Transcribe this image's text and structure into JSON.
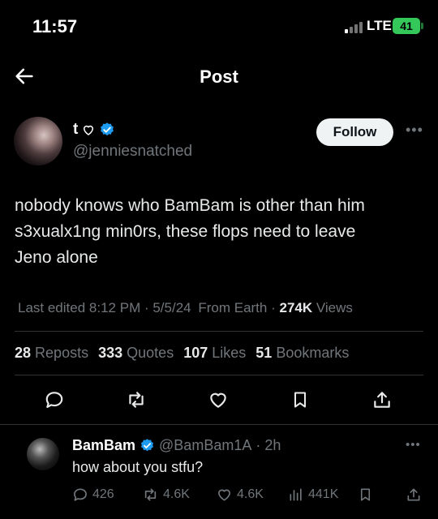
{
  "status_bar": {
    "time": "11:57",
    "network": "LTE",
    "battery": "41"
  },
  "header": {
    "title": "Post"
  },
  "post": {
    "author": {
      "display_name": "t",
      "handle": "@jenniesnatched"
    },
    "follow_label": "Follow",
    "text": "nobody knows who BamBam is other than him\ns3xualx1ng min0rs, these flops need to leave\nJeno alone",
    "meta": {
      "edited_label": "Last edited",
      "time": "8:12 PM",
      "date": "5/5/24",
      "location": "From Earth",
      "views_count": "274K",
      "views_label": "Views"
    },
    "stats": {
      "reposts": {
        "count": "28",
        "label": "Reposts"
      },
      "quotes": {
        "count": "333",
        "label": "Quotes"
      },
      "likes": {
        "count": "107",
        "label": "Likes"
      },
      "bookmarks": {
        "count": "51",
        "label": "Bookmarks"
      }
    }
  },
  "reply": {
    "display_name": "BamBam",
    "handle": "@BamBam1A",
    "time": "2h",
    "text": "how about you stfu?",
    "replies": "426",
    "reposts": "4.6K",
    "likes": "4.6K",
    "views": "441K"
  },
  "colors": {
    "background": "#000000",
    "text": "#e7e9ea",
    "muted": "#71767b",
    "verified": "#1d9bf0",
    "divider": "#2f3336"
  },
  "icons": [
    "back-arrow-icon",
    "verified-badge-icon",
    "more-icon",
    "reply-icon",
    "repost-icon",
    "like-icon",
    "bookmark-icon",
    "share-icon",
    "views-icon"
  ]
}
